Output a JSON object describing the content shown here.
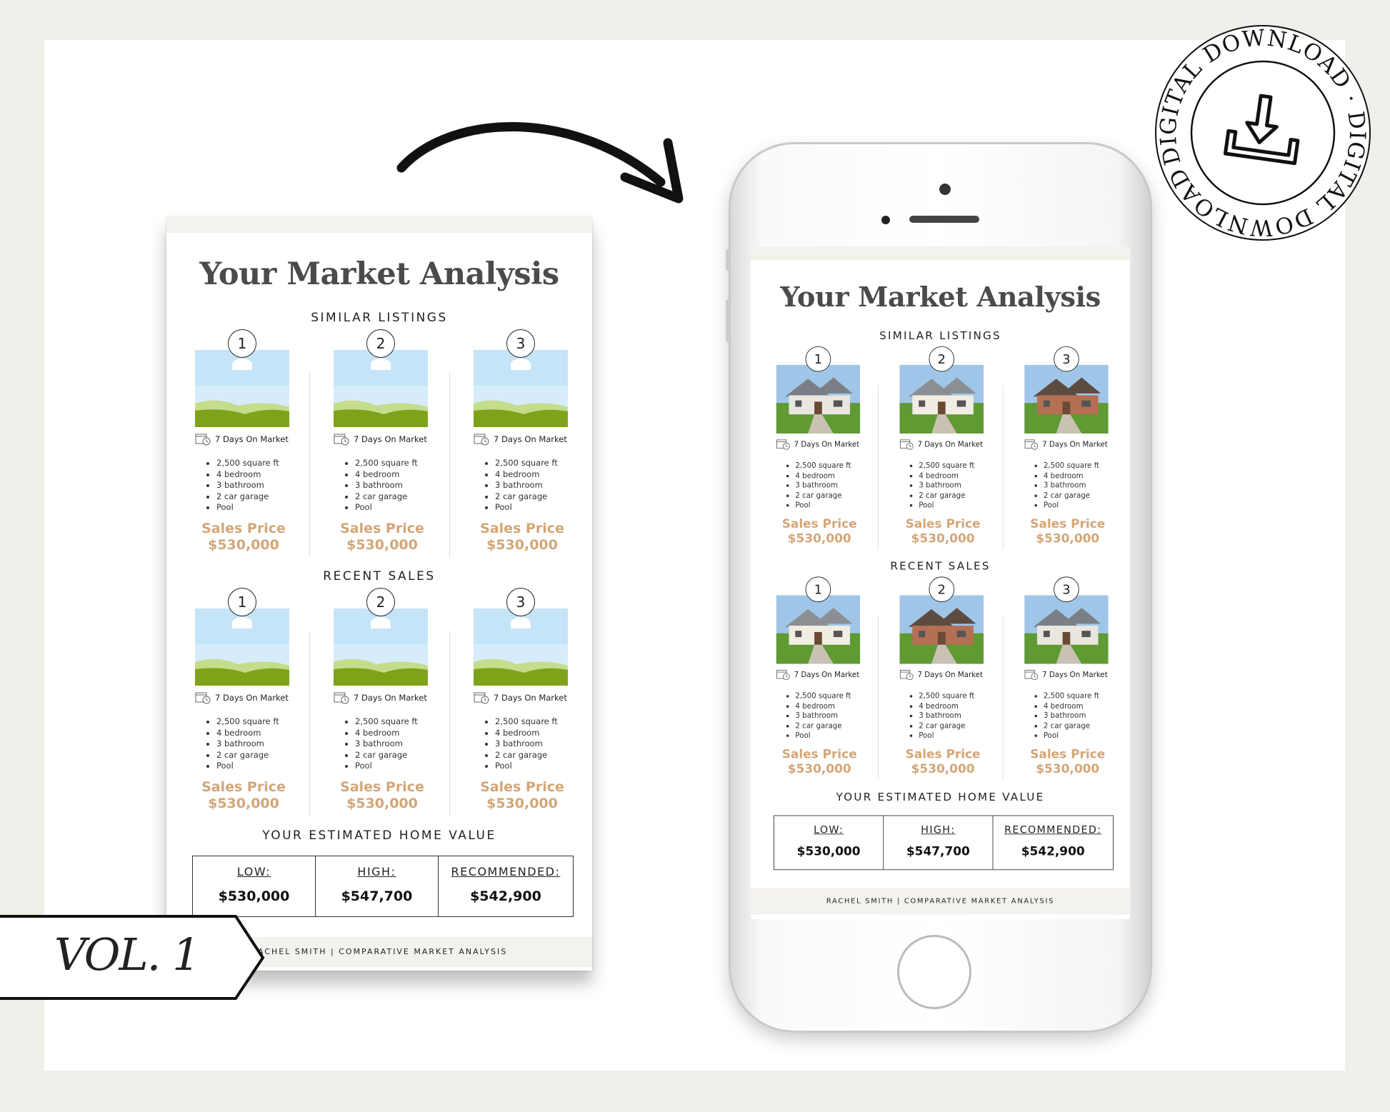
{
  "document": {
    "title": "Your Market Analysis",
    "similar_heading": "SIMILAR LISTINGS",
    "recent_heading": "RECENT SALES",
    "estimate_heading": "YOUR ESTIMATED HOME VALUE",
    "listings": [
      {
        "number": "1",
        "days": "7 Days On Market",
        "features": [
          "2,500 square ft",
          "4 bedroom",
          "3 bathroom",
          "2 car garage",
          "Pool"
        ],
        "price_label": "Sales Price",
        "price": "$530,000"
      },
      {
        "number": "2",
        "days": "7 Days On Market",
        "features": [
          "2,500 square ft",
          "4 bedroom",
          "3 bathroom",
          "2 car garage",
          "Pool"
        ],
        "price_label": "Sales Price",
        "price": "$530,000"
      },
      {
        "number": "3",
        "days": "7 Days On Market",
        "features": [
          "2,500 square ft",
          "4 bedroom",
          "3 bathroom",
          "2 car garage",
          "Pool"
        ],
        "price_label": "Sales Price",
        "price": "$530,000"
      }
    ],
    "sales": [
      {
        "number": "1",
        "days": "7 Days On Market",
        "features": [
          "2,500 square ft",
          "4 bedroom",
          "3 bathroom",
          "2 car garage",
          "Pool"
        ],
        "price_label": "Sales Price",
        "price": "$530,000"
      },
      {
        "number": "2",
        "days": "7 Days On Market",
        "features": [
          "2,500 square ft",
          "4 bedroom",
          "3 bathroom",
          "2 car garage",
          "Pool"
        ],
        "price_label": "Sales Price",
        "price": "$530,000"
      },
      {
        "number": "3",
        "days": "7 Days On Market",
        "features": [
          "2,500 square ft",
          "4 bedroom",
          "3 bathroom",
          "2 car garage",
          "Pool"
        ],
        "price_label": "Sales Price",
        "price": "$530,000"
      }
    ],
    "values": [
      {
        "label": "LOW:",
        "value": "$530,000"
      },
      {
        "label": "HIGH:",
        "value": "$547,700"
      },
      {
        "label": "RECOMMENDED:",
        "value": "$542,900"
      }
    ],
    "footer": "RACHEL SMITH | COMPARATIVE MARKET ANALYSIS"
  },
  "banner": {
    "text": "VOL. 1"
  },
  "stamp": {
    "text": "DIGITAL DOWNLOAD · DIGITAL DOWNLOAD ·",
    "icon": "download-icon"
  },
  "colors": {
    "accent": "#d3a677",
    "title": "#4b4b4b",
    "band": "#f4f2ed"
  }
}
